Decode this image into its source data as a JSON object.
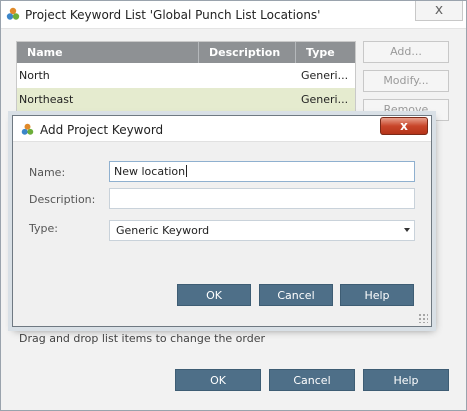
{
  "window": {
    "title": "Project Keyword List 'Global Punch List Locations'",
    "close_glyph": "x"
  },
  "table": {
    "headers": [
      "Name",
      "Description",
      "Type"
    ],
    "rows": [
      {
        "name": "North",
        "description": "",
        "type": "Generi...",
        "selected": false
      },
      {
        "name": "Northeast",
        "description": "",
        "type": "Generi...",
        "selected": true
      },
      {
        "name": "",
        "description": "",
        "type": "",
        "selected": false
      }
    ]
  },
  "side_buttons": {
    "add": "Add...",
    "modify": "Modify...",
    "remove": "Remove"
  },
  "hint": "Drag and drop list items to change the order",
  "bottom_buttons": {
    "ok": "OK",
    "cancel": "Cancel",
    "help": "Help"
  },
  "dialog": {
    "title": "Add Project Keyword",
    "close_glyph": "x",
    "fields": {
      "name_label": "Name:",
      "name_value": "New location",
      "description_label": "Description:",
      "description_value": "",
      "type_label": "Type:",
      "type_value": "Generic Keyword"
    },
    "buttons": {
      "ok": "OK",
      "cancel": "Cancel",
      "help": "Help"
    }
  },
  "colors": {
    "primary_button": "#4e6f88",
    "table_header": "#8e9194",
    "selected_row": "#e5ebcf",
    "close_button": "#c8452a"
  }
}
